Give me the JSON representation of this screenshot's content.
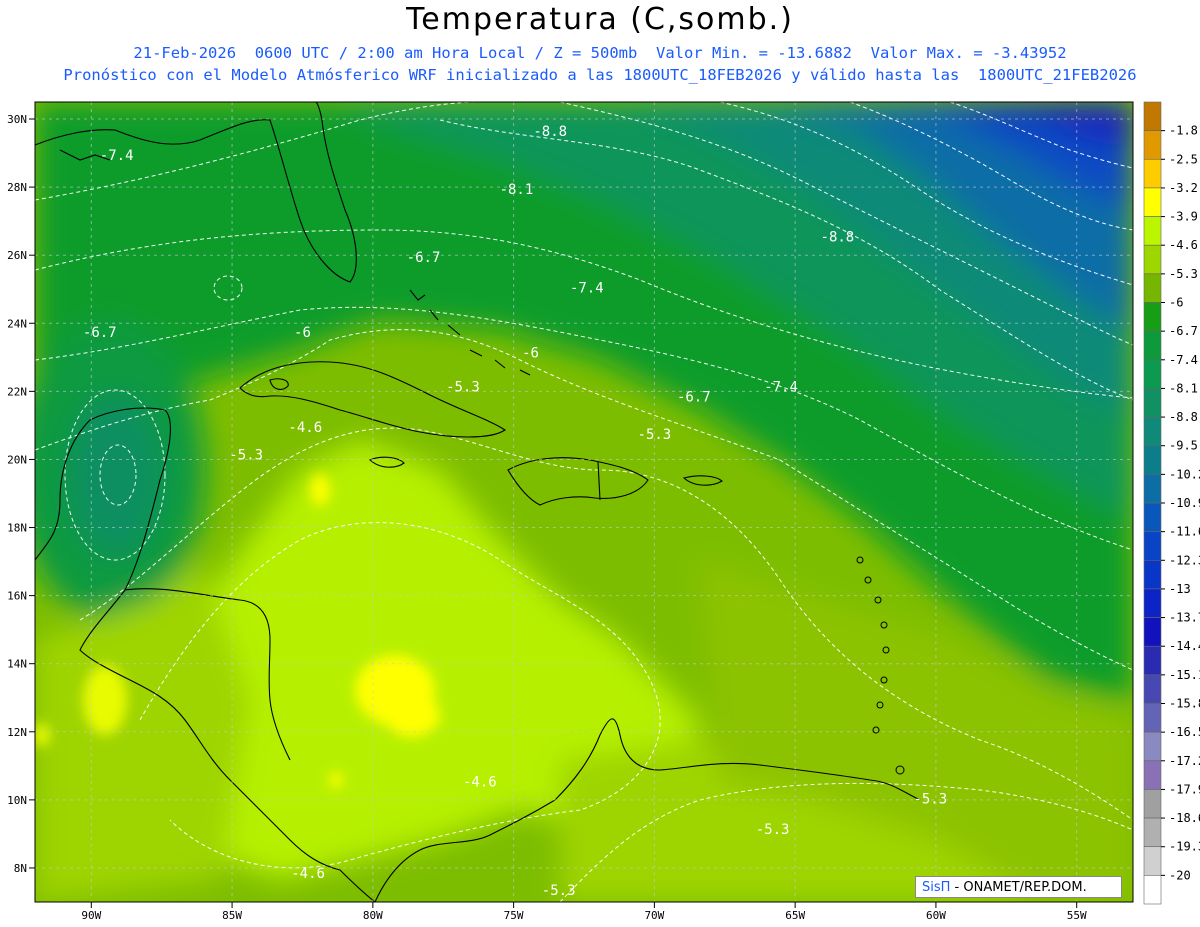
{
  "header": {
    "title": "Temperatura (C,somb.)",
    "line1": "21-Feb-2026  0600 UTC / 2:00 am Hora Local / Z = 500mb  Valor Min. = -13.6882  Valor Max. = -3.43952",
    "line2": "Pronóstico con el Modelo Atmósferico WRF inicializado a las 1800UTC_18FEB2026 y válido hasta las  1800UTC_21FEB2026"
  },
  "map": {
    "lon_range": [
      -92,
      -53
    ],
    "lat_range": [
      7,
      30.5
    ],
    "lon_ticks": [
      "90W",
      "85W",
      "80W",
      "75W",
      "70W",
      "65W",
      "60W",
      "55W"
    ],
    "lat_ticks": [
      "30N",
      "28N",
      "26N",
      "24N",
      "22N",
      "20N",
      "18N",
      "16N",
      "14N",
      "12N",
      "10N",
      "8N"
    ],
    "grid": "dashed",
    "contour_labels": [
      {
        "text": "-8.8",
        "lon": -73.7,
        "lat": 29.5
      },
      {
        "text": "-7.4",
        "lon": -89.1,
        "lat": 28.8
      },
      {
        "text": "-8.1",
        "lon": -74.9,
        "lat": 27.8
      },
      {
        "text": "-8.8",
        "lon": -63.5,
        "lat": 26.4
      },
      {
        "text": "-6.7",
        "lon": -78.2,
        "lat": 25.8
      },
      {
        "text": "-7.4",
        "lon": -72.4,
        "lat": 24.9
      },
      {
        "text": "-6.7",
        "lon": -89.7,
        "lat": 23.6
      },
      {
        "text": "-6",
        "lon": -82.5,
        "lat": 23.6
      },
      {
        "text": "-6",
        "lon": -74.4,
        "lat": 23.0
      },
      {
        "text": "-5.3",
        "lon": -76.8,
        "lat": 22.0
      },
      {
        "text": "-7.4",
        "lon": -65.5,
        "lat": 22.0
      },
      {
        "text": "-6.7",
        "lon": -68.6,
        "lat": 21.7
      },
      {
        "text": "-4.6",
        "lon": -82.4,
        "lat": 20.8
      },
      {
        "text": "-5.3",
        "lon": -70.0,
        "lat": 20.6
      },
      {
        "text": "-5.3",
        "lon": -84.5,
        "lat": 20.0
      },
      {
        "text": "-4.6",
        "lon": -76.2,
        "lat": 10.4
      },
      {
        "text": "-5.3",
        "lon": -60.2,
        "lat": 9.9
      },
      {
        "text": "-5.3",
        "lon": -65.8,
        "lat": 9.0
      },
      {
        "text": "-4.6",
        "lon": -82.3,
        "lat": 7.7
      },
      {
        "text": "-5.3",
        "lon": -73.4,
        "lat": 7.2
      }
    ]
  },
  "colorbar": {
    "levels": [
      "-1.8",
      "-2.5",
      "-3.2",
      "-3.9",
      "-4.6",
      "-5.3",
      "-6",
      "-6.7",
      "-7.4",
      "-8.1",
      "-8.8",
      "-9.5",
      "-10.2",
      "-10.9",
      "-11.6",
      "-12.3",
      "-13",
      "-13.7",
      "-14.4",
      "-15.1",
      "-15.8",
      "-16.5",
      "-17.2",
      "-17.9",
      "-18.6",
      "-19.3",
      "-20"
    ],
    "colors": [
      "#c07800",
      "#e09a00",
      "#ffcc00",
      "#ffff00",
      "#bbf500",
      "#9ed600",
      "#77b600",
      "#169e16",
      "#0c9a3a",
      "#0b9a50",
      "#109164",
      "#0f8a78",
      "#0b7e8a",
      "#0c6ea4",
      "#0a57bb",
      "#0a44c6",
      "#0a36c8",
      "#0c24c6",
      "#1212bc",
      "#2a2ab2",
      "#4848b2",
      "#6464b6",
      "#8a8ac0",
      "#8a70b4",
      "#a0a0a0",
      "#b0b0b0",
      "#d0d0d0",
      "#ffffff"
    ]
  },
  "credit": {
    "brand": "SisΠ",
    "org": " - ONAMET/REP.DOM."
  }
}
